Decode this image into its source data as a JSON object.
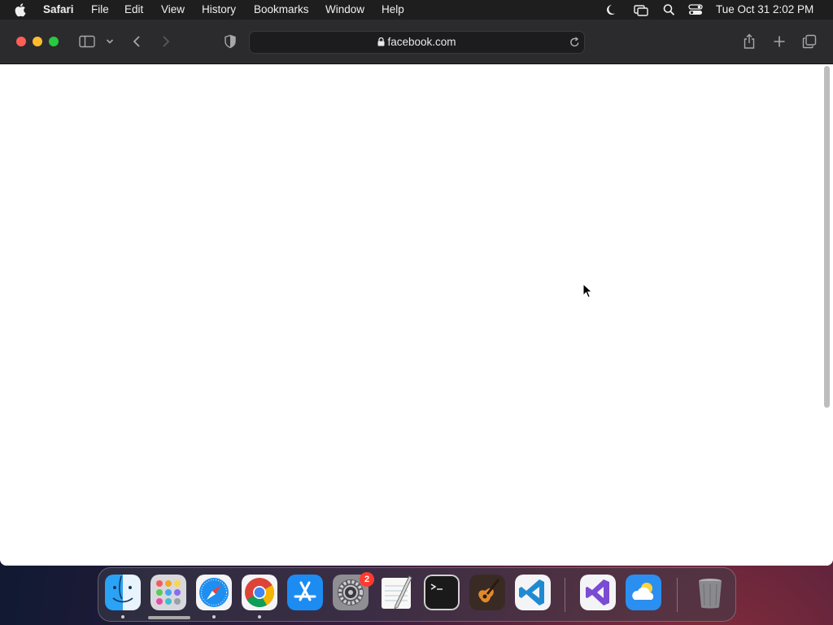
{
  "menubar": {
    "app_name": "Safari",
    "menus": [
      "File",
      "Edit",
      "View",
      "History",
      "Bookmarks",
      "Window",
      "Help"
    ],
    "clock": "Tue Oct 31  2:02 PM"
  },
  "browser": {
    "url": "facebook.com"
  },
  "dock": {
    "apps": [
      "Finder",
      "Launchpad",
      "Safari",
      "Google Chrome",
      "App Store",
      "System Settings",
      "TextEdit",
      "Terminal",
      "GarageBand",
      "Visual Studio Code",
      "Visual Studio",
      "Weather",
      "Trash"
    ],
    "settings_badge": "2"
  },
  "colors": {
    "close": "#ff5f57",
    "minimize": "#febc2e",
    "zoom": "#28c840",
    "toolbar": "#2b2b2d",
    "menubar": "#1e1e1e"
  }
}
